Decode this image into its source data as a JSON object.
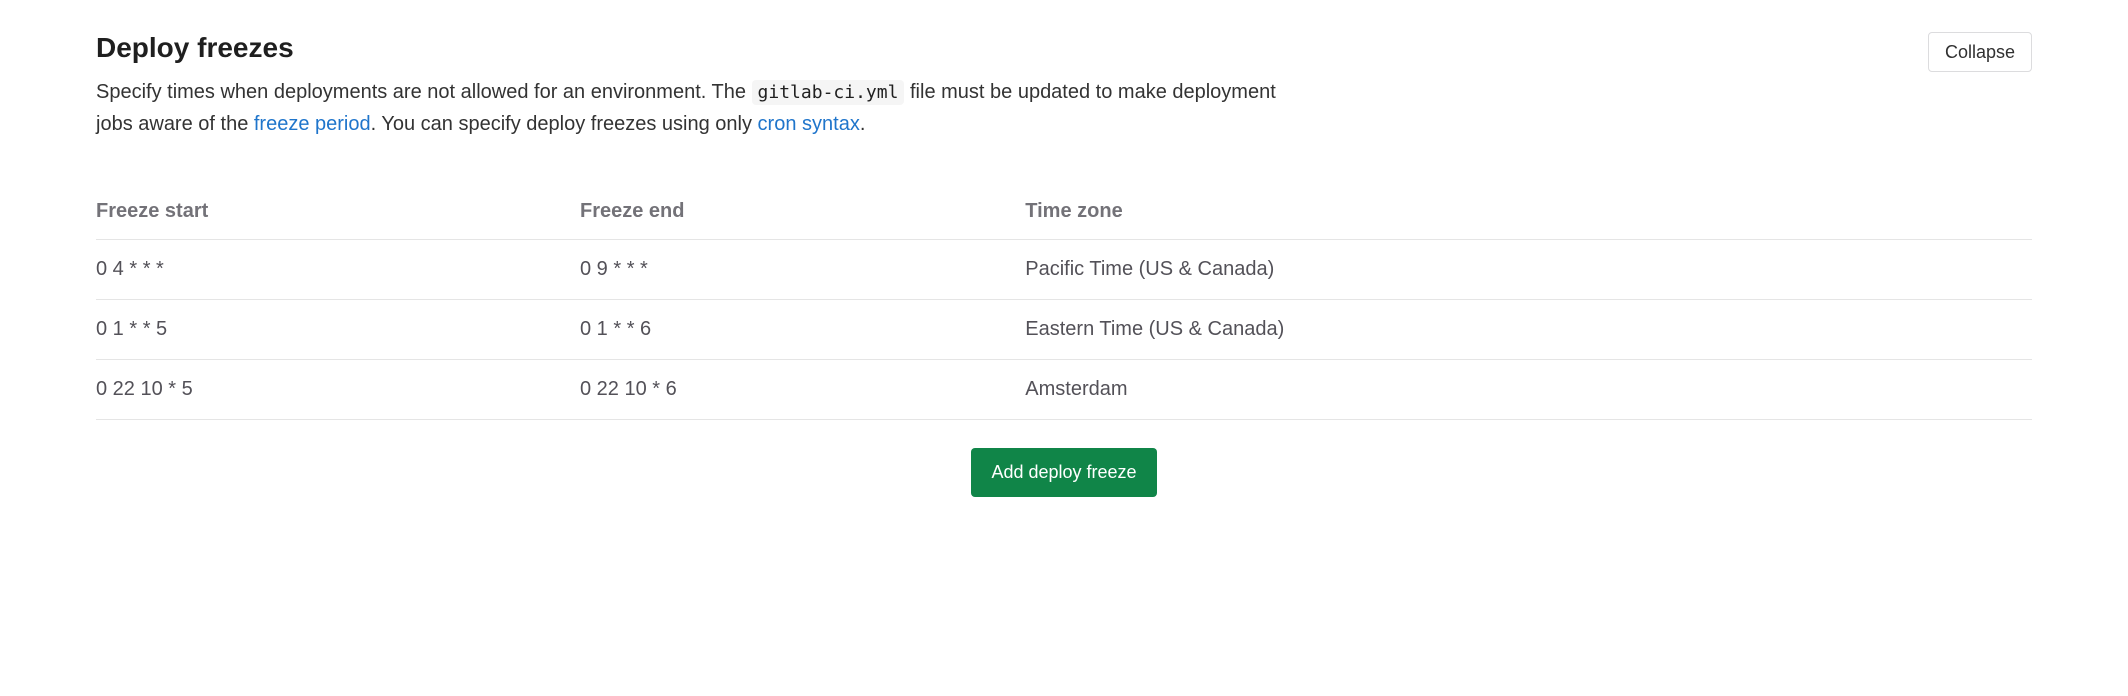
{
  "header": {
    "title": "Deploy freezes",
    "collapse_label": "Collapse"
  },
  "description": {
    "part1": "Specify times when deployments are not allowed for an environment. The ",
    "code": "gitlab-ci.yml",
    "part2": " file must be updated to make deployment jobs aware of the ",
    "link1": "freeze period",
    "part3": ". You can specify deploy freezes using only ",
    "link2": "cron syntax",
    "part4": "."
  },
  "table": {
    "headers": {
      "start": "Freeze start",
      "end": "Freeze end",
      "timezone": "Time zone"
    },
    "rows": [
      {
        "start": "0 4 * * *",
        "end": "0 9 * * *",
        "timezone": "Pacific Time (US & Canada)"
      },
      {
        "start": "0 1 * * 5",
        "end": "0 1 * * 6",
        "timezone": "Eastern Time (US & Canada)"
      },
      {
        "start": "0 22 10 * 5",
        "end": "0 22 10 * 6",
        "timezone": "Amsterdam"
      }
    ]
  },
  "actions": {
    "add_label": "Add deploy freeze"
  }
}
